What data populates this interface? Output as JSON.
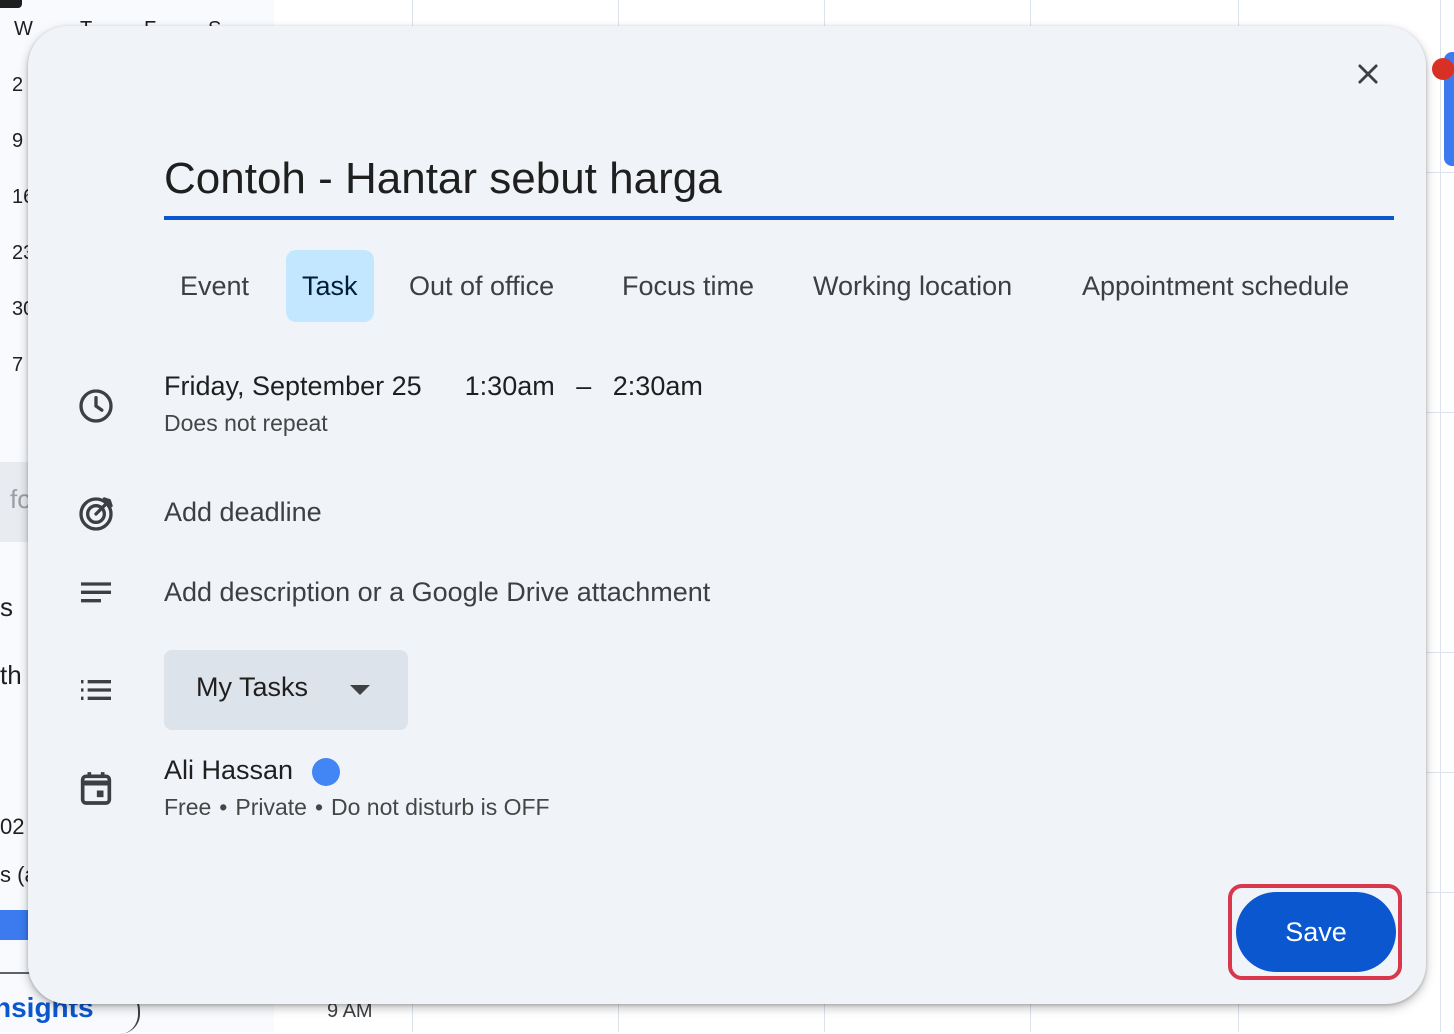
{
  "background": {
    "weekday_letters": [
      "W",
      "T",
      "F",
      "S"
    ],
    "dates": [
      "2",
      "9",
      "16",
      "23",
      "30",
      "7"
    ],
    "side_fragments": [
      "fo",
      "s",
      "th",
      "02",
      "s (a"
    ],
    "insights_label": "nsights",
    "time_label": "9 AM"
  },
  "dialog": {
    "close_icon": "close-icon",
    "title": "Contoh - Hantar sebut harga",
    "tabs": [
      {
        "label": "Event",
        "active": false
      },
      {
        "label": "Task",
        "active": true
      },
      {
        "label": "Out of office",
        "active": false
      },
      {
        "label": "Focus time",
        "active": false
      },
      {
        "label": "Working location",
        "active": false
      },
      {
        "label": "Appointment schedule",
        "active": false
      }
    ],
    "datetime": {
      "date": "Friday, September 25",
      "start": "1:30am",
      "separator": "–",
      "end": "2:30am",
      "repeat": "Does not repeat"
    },
    "deadline": {
      "label": "Add deadline"
    },
    "description": {
      "placeholder": "Add description or a Google Drive attachment"
    },
    "task_list": {
      "selected": "My Tasks"
    },
    "owner": {
      "name": "Ali Hassan",
      "color": "#4285f4",
      "availability": "Free",
      "visibility": "Private",
      "dnd": "Do not disturb is OFF"
    },
    "save_label": "Save"
  },
  "colors": {
    "accent": "#0b57d0",
    "tab_active_bg": "#c2e7ff",
    "dialog_bg": "#f0f4f9",
    "highlight_outline": "#d9374b"
  }
}
